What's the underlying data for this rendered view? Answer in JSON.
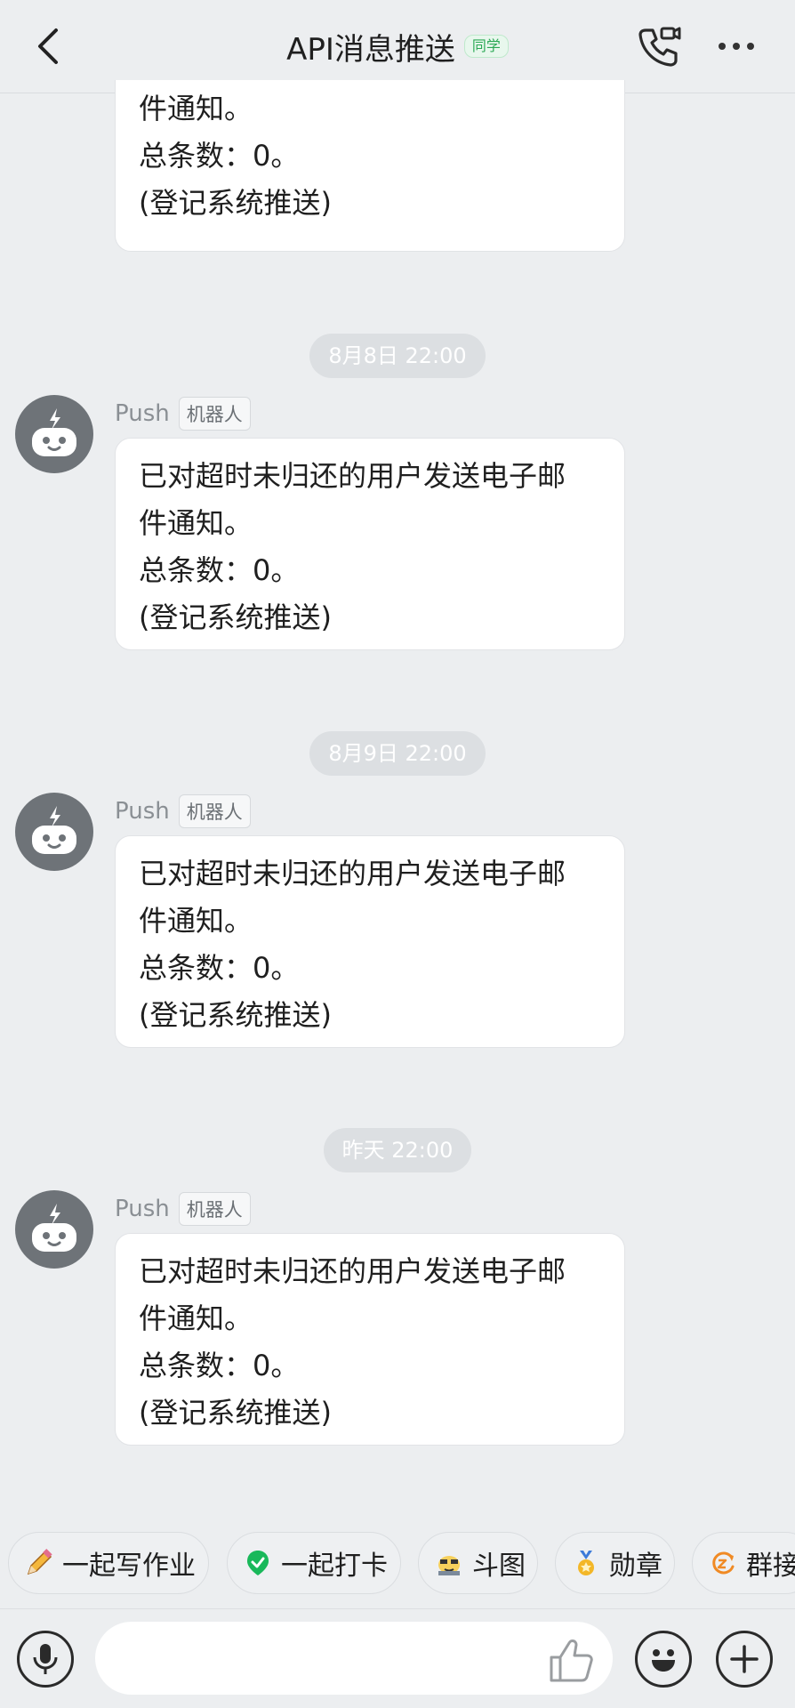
{
  "header": {
    "title": "API消息推送",
    "tag": "同学"
  },
  "messages": [
    {
      "partial": true,
      "lines": [
        "件通知。",
        "总条数：0。",
        "(登记系统推送)"
      ]
    },
    {
      "time": "8月8日 22:00",
      "sender": "Push",
      "sender_tag": "机器人",
      "lines": [
        "已对超时未归还的用户发送电子邮",
        "件通知。",
        "总条数：0。",
        "(登记系统推送)"
      ]
    },
    {
      "time": "8月9日 22:00",
      "sender": "Push",
      "sender_tag": "机器人",
      "lines": [
        "已对超时未归还的用户发送电子邮",
        "件通知。",
        "总条数：0。",
        "(登记系统推送)"
      ]
    },
    {
      "time": "昨天 22:00",
      "sender": "Push",
      "sender_tag": "机器人",
      "lines": [
        "已对超时未归还的用户发送电子邮",
        "件通知。",
        "总条数：0。",
        "(登记系统推送)"
      ]
    }
  ],
  "quick_actions": [
    {
      "label": "一起写作业",
      "icon": "pencil-icon"
    },
    {
      "label": "一起打卡",
      "icon": "green-check-icon"
    },
    {
      "label": "斗图",
      "icon": "sticker-face-icon"
    },
    {
      "label": "勋章",
      "icon": "medal-icon"
    },
    {
      "label": "群接",
      "icon": "relay-icon"
    }
  ],
  "input": {
    "placeholder": ""
  },
  "colors": {
    "background": "#eceef0",
    "bubble": "#ffffff",
    "tag_green": "#2aa854",
    "avatar": "#6e7378"
  }
}
